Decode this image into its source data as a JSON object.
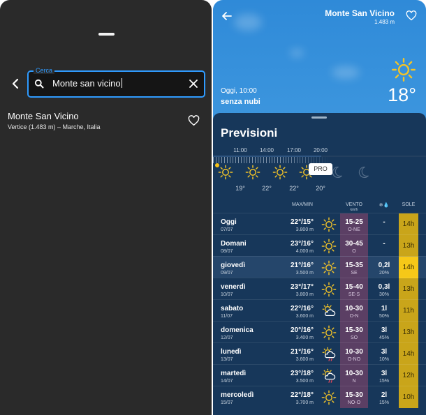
{
  "search_screen": {
    "search_label": "Cerca",
    "search_value": "Monte san vicino",
    "result": {
      "name": "Monte San Vicino",
      "subtitle": "Vertice (1.483 m) – Marche, Italia"
    }
  },
  "weather": {
    "location": "Monte San Vicino",
    "altitude": "1.483 m",
    "now_time": "Oggi, 10:00",
    "condition": "senza nubi",
    "temperature": "18°",
    "forecast_title": "Previsioni",
    "pro_badge": "PRO",
    "hourly": [
      {
        "time": "11:00",
        "temp": "19°"
      },
      {
        "time": "14:00",
        "temp": "22°"
      },
      {
        "time": "17:00",
        "temp": "22°"
      },
      {
        "time": "20:00",
        "temp": "20°"
      }
    ],
    "columns": {
      "temp": "MAX/MIN",
      "wind": "VENTO",
      "wind_unit": "km/h",
      "precip": "❄💧",
      "sun": "SOLE"
    },
    "days": [
      {
        "name": "Oggi",
        "date": "07/07",
        "temp": "22°/15°",
        "alt": "3.800 m",
        "icon": "sun-icon",
        "wind": "15-25",
        "dir": "O-NE",
        "precip": "-",
        "pct": "",
        "sun": "14h",
        "sun_bright": false
      },
      {
        "name": "Domani",
        "date": "08/07",
        "temp": "23°/16°",
        "alt": "4.000 m",
        "icon": "sun-icon",
        "wind": "30-45",
        "dir": "O",
        "precip": "-",
        "pct": "",
        "sun": "13h",
        "sun_bright": false
      },
      {
        "name": "giovedì",
        "date": "09/07",
        "temp": "21°/16°",
        "alt": "3.500 m",
        "icon": "sun-icon",
        "wind": "15-35",
        "dir": "SE",
        "precip": "0,2l",
        "pct": "20%",
        "sun": "14h",
        "sun_bright": true
      },
      {
        "name": "venerdì",
        "date": "10/07",
        "temp": "23°/17°",
        "alt": "3.800 m",
        "icon": "sun-icon",
        "wind": "15-40",
        "dir": "SE-S",
        "precip": "0,3l",
        "pct": "30%",
        "sun": "13h",
        "sun_bright": false
      },
      {
        "name": "sabato",
        "date": "11/07",
        "temp": "22°/16°",
        "alt": "3.600 m",
        "icon": "partly-cloudy-icon",
        "wind": "10-30",
        "dir": "O-N",
        "precip": "1l",
        "pct": "50%",
        "sun": "11h",
        "sun_bright": false
      },
      {
        "name": "domenica",
        "date": "12/07",
        "temp": "20°/16°",
        "alt": "3.400 m",
        "icon": "sun-icon",
        "wind": "15-30",
        "dir": "SO",
        "precip": "3l",
        "pct": "45%",
        "sun": "13h",
        "sun_bright": false
      },
      {
        "name": "lunedì",
        "date": "13/07",
        "temp": "21°/16°",
        "alt": "3.600 m",
        "icon": "sun-rain-icon",
        "wind": "10-30",
        "dir": "O-NO",
        "precip": "3l",
        "pct": "10%",
        "sun": "14h",
        "sun_bright": false
      },
      {
        "name": "martedì",
        "date": "14/07",
        "temp": "23°/18°",
        "alt": "3.500 m",
        "icon": "sun-rain-icon",
        "wind": "10-30",
        "dir": "N",
        "precip": "3l",
        "pct": "15%",
        "sun": "12h",
        "sun_bright": false
      },
      {
        "name": "mercoledì",
        "date": "15/07",
        "temp": "22°/18°",
        "alt": "3.700 m",
        "icon": "sun-icon",
        "wind": "15-30",
        "dir": "NO-O",
        "precip": "2l",
        "pct": "15%",
        "sun": "10h",
        "sun_bright": false
      }
    ]
  }
}
